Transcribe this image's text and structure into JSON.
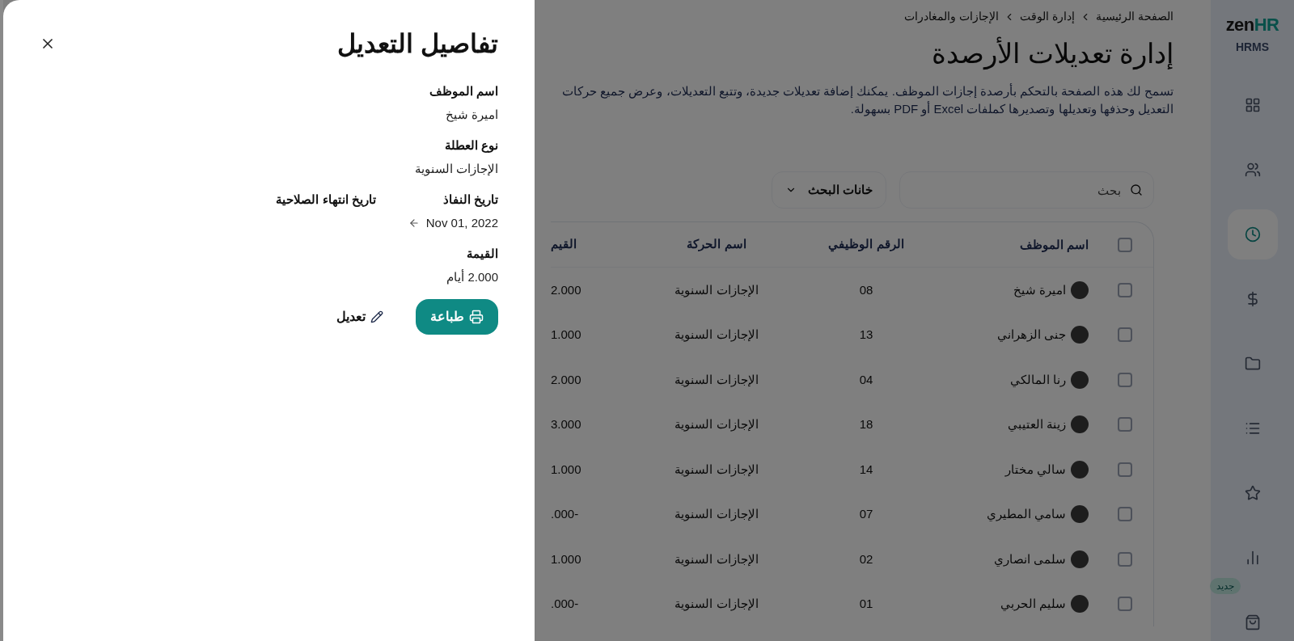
{
  "drawer": {
    "title": "تفاصيل التعديل",
    "fields": [
      {
        "label": "اسم الموظف",
        "value": "اميرة شيخ"
      },
      {
        "label": "نوع العطلة",
        "value": "الإجازات السنوية"
      }
    ],
    "dates": {
      "start_label": "تاريخ النفاذ",
      "start_value": "Nov 01, 2022",
      "end_label": "تاريخ انتهاء الصلاحية"
    },
    "amount": {
      "label": "القيمة",
      "value": "2.000 أيام"
    },
    "print_button": "طباعة",
    "edit_button": "تعديل"
  },
  "breadcrumb": [
    "الصفحة الرئيسية",
    "إدارة الوقت",
    "الإجازات والمغادرات"
  ],
  "page_title": "إدارة تعديلات الأرصدة",
  "description": "تسمح لك هذه الصفحة بالتحكم بأرصدة إجازات الموظف. يمكنك إضافة تعديلات جديدة، وتتبع التعديلات، وعرض جميع حركات التعديل وحذفها وتعديلها وتصديرها كملفات Excel أو PDF بسهولة.",
  "search": {
    "placeholder": "بحث"
  },
  "search_fields_button": "خانات البحث",
  "table": {
    "columns": [
      "اسم الموظف",
      "الرقم الوظيفي",
      "اسم الحركة",
      "القيم"
    ],
    "header_checked": false,
    "rows": [
      {
        "checked": false,
        "name": "اميرة شيخ",
        "id": "08",
        "type": "الإجازات السنوية",
        "value": "2.000"
      },
      {
        "checked": false,
        "name": "جنى الزهراني",
        "id": "13",
        "type": "الإجازات السنوية",
        "value": "1.000"
      },
      {
        "checked": false,
        "name": "رنا المالكي",
        "id": "04",
        "type": "الإجازات السنوية",
        "value": "2.000"
      },
      {
        "checked": false,
        "name": "زينة العتيبي",
        "id": "18",
        "type": "الإجازات السنوية",
        "value": "3.000"
      },
      {
        "checked": false,
        "name": "سالي مختار",
        "id": "14",
        "type": "الإجازات السنوية",
        "value": "1.000"
      },
      {
        "checked": false,
        "name": "سامي المطيري",
        "id": "07",
        "type": "الإجازات السنوية",
        "value": ".000-"
      },
      {
        "checked": false,
        "name": "سلمى انصاري",
        "id": "02",
        "type": "الإجازات السنوية",
        "value": "1.000"
      },
      {
        "checked": false,
        "name": "سليم الحربي",
        "id": "01",
        "type": "الإجازات السنوية",
        "value": ".000-"
      }
    ]
  },
  "sidebar": {
    "logo_main": "zen",
    "logo_accent": "HR",
    "subtitle": "HRMS",
    "items": [
      {
        "selected": false
      },
      {
        "selected": false
      },
      {
        "selected": true
      },
      {
        "selected": false
      },
      {
        "selected": false
      },
      {
        "selected": false
      },
      {
        "selected": false
      },
      {
        "selected": false
      },
      {
        "selected": false
      }
    ],
    "badge": "جديد"
  }
}
